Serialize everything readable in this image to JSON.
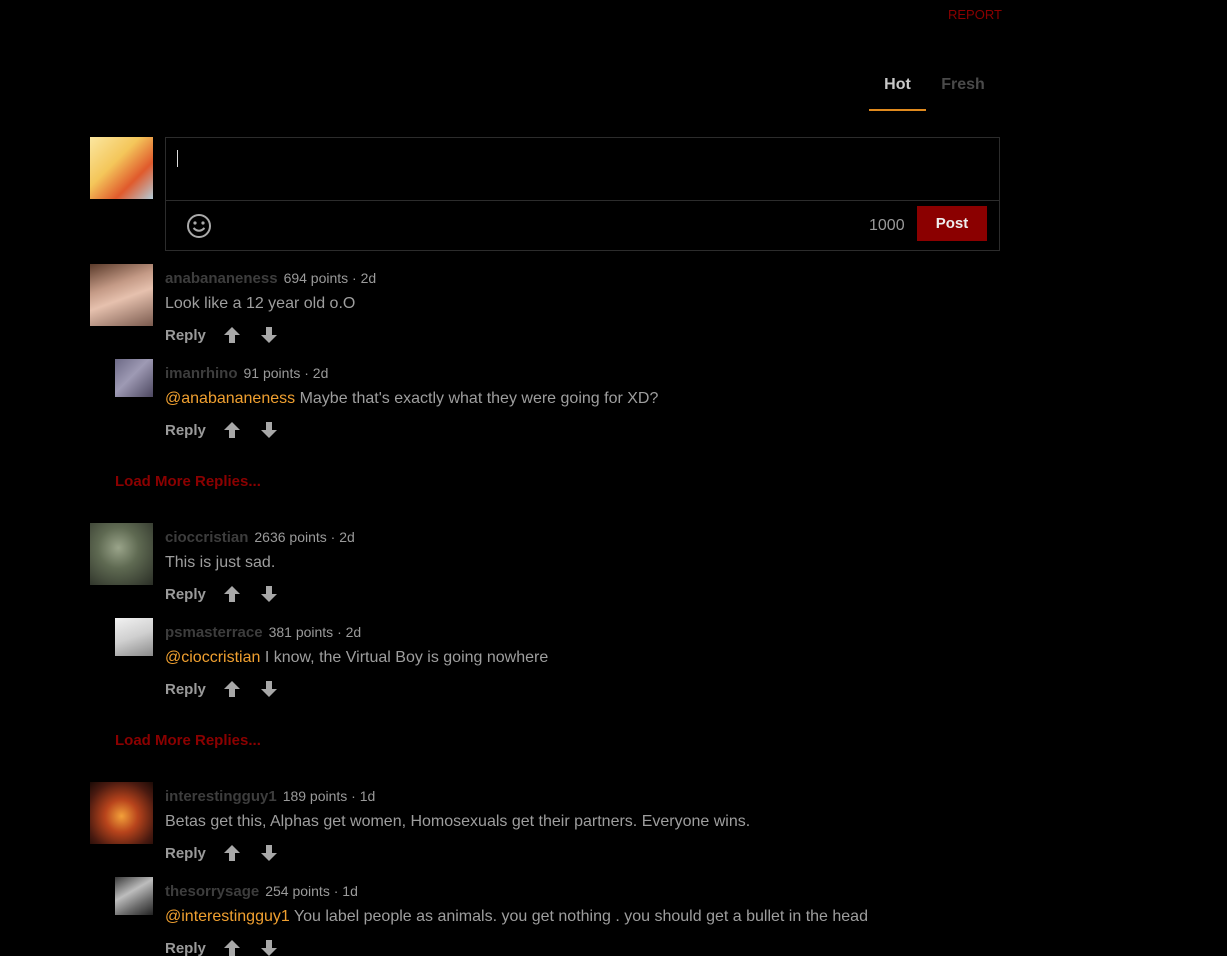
{
  "header": {
    "report_label": "REPORT"
  },
  "tabs": [
    {
      "label": "Hot",
      "active": true
    },
    {
      "label": "Fresh",
      "active": false
    }
  ],
  "composer": {
    "value": "",
    "char_count": "1000",
    "post_label": "Post",
    "emoji_icon": "smiley-icon"
  },
  "actions": {
    "reply_label": "Reply",
    "upvote_icon": "arrow-up-icon",
    "downvote_icon": "arrow-down-icon"
  },
  "threads": [
    {
      "comment": {
        "username": "anabananeness",
        "points": "694 points",
        "age": "2d",
        "text": "Look like a 12 year old o.O"
      },
      "replies": [
        {
          "username": "imanrhino",
          "points": "91 points",
          "age": "2d",
          "mention": "@anabananeness",
          "text": " Maybe that's exactly what they were going for XD?"
        }
      ],
      "load_more_label": "Load More Replies..."
    },
    {
      "comment": {
        "username": "cioccristian",
        "points": "2636 points",
        "age": "2d",
        "text": "This is just sad."
      },
      "replies": [
        {
          "username": "psmasterrace",
          "points": "381 points",
          "age": "2d",
          "mention": "@cioccristian",
          "text": " I know, the Virtual Boy is going nowhere"
        }
      ],
      "load_more_label": "Load More Replies..."
    },
    {
      "comment": {
        "username": "interestingguy1",
        "points": "189 points",
        "age": "1d",
        "text": "Betas get this, Alphas get women, Homosexuals get their partners. Everyone wins."
      },
      "replies": [
        {
          "username": "thesorrysage",
          "points": "254 points",
          "age": "1d",
          "mention": "@interestingguy1",
          "text": " You label people as animals. you get nothing . you should get a bullet in the head"
        }
      ]
    }
  ],
  "colors": {
    "accent": "#e08a1e",
    "brand_red": "#8b0000",
    "mention": "#f0a030",
    "background": "#000000"
  }
}
